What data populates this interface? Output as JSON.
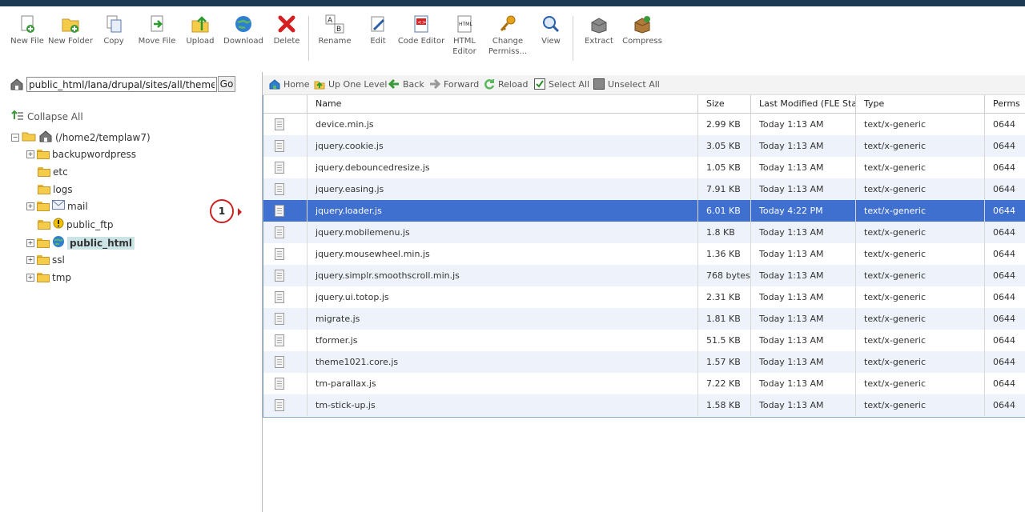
{
  "toolbar": {
    "buttons": [
      {
        "label": "New File",
        "icon": "new-file-icon"
      },
      {
        "label": "New Folder",
        "icon": "new-folder-icon"
      },
      {
        "label": "Copy",
        "icon": "copy-icon"
      },
      {
        "label": "Move File",
        "icon": "move-file-icon"
      },
      {
        "label": "Upload",
        "icon": "upload-icon"
      },
      {
        "label": "Download",
        "icon": "download-icon"
      },
      {
        "label": "Delete",
        "icon": "delete-icon"
      },
      {
        "label": "Rename",
        "icon": "rename-icon"
      },
      {
        "label": "Edit",
        "icon": "edit-icon"
      },
      {
        "label": "Code Editor",
        "icon": "code-editor-icon"
      },
      {
        "label": "HTML Editor",
        "icon": "html-editor-icon"
      },
      {
        "label": "Change Permiss...",
        "icon": "change-permissions-icon"
      },
      {
        "label": "View",
        "icon": "view-icon"
      },
      {
        "label": "Extract",
        "icon": "extract-icon"
      },
      {
        "label": "Compress",
        "icon": "compress-icon"
      }
    ]
  },
  "pathbar": {
    "path": "public_html/lana/drupal/sites/all/themes",
    "go_label": "Go"
  },
  "nav": {
    "home": "Home",
    "up": "Up One Level",
    "back": "Back",
    "forward": "Forward",
    "reload": "Reload",
    "select_all": "Select All",
    "unselect_all": "Unselect All"
  },
  "sidebar": {
    "collapse_all": "Collapse All",
    "root": "(/home2/templaw7)",
    "folders": [
      "backupwordpress",
      "etc",
      "logs",
      "mail",
      "public_ftp",
      "public_html",
      "ssl",
      "tmp"
    ]
  },
  "callout": {
    "number": "1"
  },
  "table": {
    "columns": [
      "Name",
      "Size",
      "Last Modified (FLE Standard)",
      "Type",
      "Perms"
    ],
    "rows": [
      {
        "name": "device.min.js",
        "size": "2.99 KB",
        "modified": "Today 1:13 AM",
        "type": "text/x-generic",
        "perms": "0644"
      },
      {
        "name": "jquery.cookie.js",
        "size": "3.05 KB",
        "modified": "Today 1:13 AM",
        "type": "text/x-generic",
        "perms": "0644"
      },
      {
        "name": "jquery.debouncedresize.js",
        "size": "1.05 KB",
        "modified": "Today 1:13 AM",
        "type": "text/x-generic",
        "perms": "0644"
      },
      {
        "name": "jquery.easing.js",
        "size": "7.91 KB",
        "modified": "Today 1:13 AM",
        "type": "text/x-generic",
        "perms": "0644"
      },
      {
        "name": "jquery.loader.js",
        "size": "6.01 KB",
        "modified": "Today 4:22 PM",
        "type": "text/x-generic",
        "perms": "0644"
      },
      {
        "name": "jquery.mobilemenu.js",
        "size": "1.8 KB",
        "modified": "Today 1:13 AM",
        "type": "text/x-generic",
        "perms": "0644"
      },
      {
        "name": "jquery.mousewheel.min.js",
        "size": "1.36 KB",
        "modified": "Today 1:13 AM",
        "type": "text/x-generic",
        "perms": "0644"
      },
      {
        "name": "jquery.simplr.smoothscroll.min.js",
        "size": "768 bytes",
        "modified": "Today 1:13 AM",
        "type": "text/x-generic",
        "perms": "0644"
      },
      {
        "name": "jquery.ui.totop.js",
        "size": "2.31 KB",
        "modified": "Today 1:13 AM",
        "type": "text/x-generic",
        "perms": "0644"
      },
      {
        "name": "migrate.js",
        "size": "1.81 KB",
        "modified": "Today 1:13 AM",
        "type": "text/x-generic",
        "perms": "0644"
      },
      {
        "name": "tformer.js",
        "size": "51.5 KB",
        "modified": "Today 1:13 AM",
        "type": "text/x-generic",
        "perms": "0644"
      },
      {
        "name": "theme1021.core.js",
        "size": "1.57 KB",
        "modified": "Today 1:13 AM",
        "type": "text/x-generic",
        "perms": "0644"
      },
      {
        "name": "tm-parallax.js",
        "size": "7.22 KB",
        "modified": "Today 1:13 AM",
        "type": "text/x-generic",
        "perms": "0644"
      },
      {
        "name": "tm-stick-up.js",
        "size": "1.58 KB",
        "modified": "Today 1:13 AM",
        "type": "text/x-generic",
        "perms": "0644"
      }
    ],
    "selected_index": 4
  },
  "colors": {
    "topbar": "#1c3a52",
    "selection": "#3f6fcf",
    "alt_row": "#eef3fb",
    "callout": "#cc2222"
  }
}
